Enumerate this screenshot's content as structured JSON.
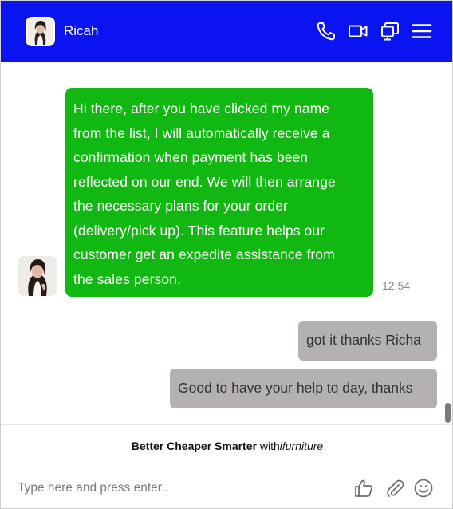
{
  "header": {
    "contact_name": "Ricah",
    "icons": [
      "avatar",
      "phone-icon",
      "video-icon",
      "screens-icon",
      "menu-icon"
    ],
    "background": "#0a14f0"
  },
  "messages": [
    {
      "direction": "incoming",
      "text": "Hi there, after you have clicked my name from the list, I will automatically receive a confirmation when payment has been reflected on our end. We will then arrange the necessary plans for your order (delivery/pick up). This feature helps our customer get an expedite assistance from the sales person.",
      "lines": [
        "Hi there, after you have clicked my name",
        "from the list, I will automatically receive a",
        "confirmation when payment has been",
        "reflected on our end. We will then arrange",
        "the necessary plans for your order",
        "(delivery/pick up). This feature helps our",
        "customer get an expedite assistance from",
        "the sales person."
      ],
      "time": "12:54",
      "color": "#12b812"
    },
    {
      "direction": "outgoing",
      "text": "got it thanks Richa",
      "color": "#b5b0b1"
    },
    {
      "direction": "outgoing",
      "text": "Good to have your help to day, thanks",
      "color": "#b5b0b1"
    }
  ],
  "footer": {
    "brand_bold": "Better Cheaper Smarter",
    "brand_with": " with",
    "brand_italic": "ifurniture"
  },
  "composer": {
    "placeholder": "Type here and press enter..",
    "icons": [
      "thumbs-up-icon",
      "paperclip-icon",
      "smiley-icon"
    ]
  }
}
